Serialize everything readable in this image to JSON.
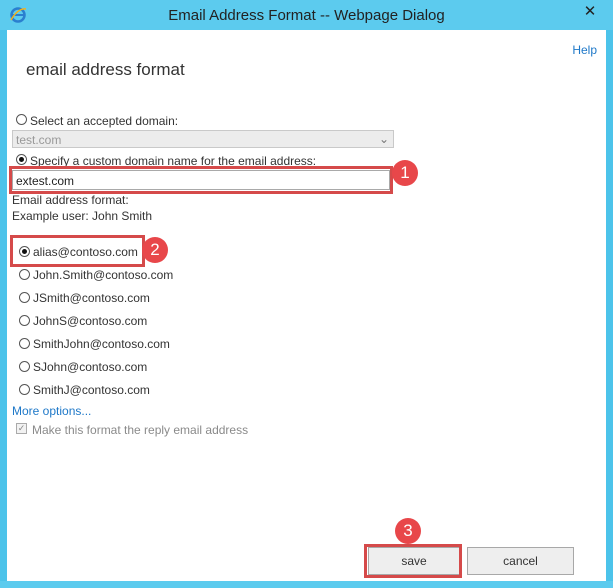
{
  "window": {
    "title": "Email Address Format -- Webpage Dialog",
    "close_glyph": "✕",
    "app_icon": "ie-icon"
  },
  "dialog": {
    "help_label": "Help",
    "heading": "email address format",
    "accepted_domain_label": "Select an accepted domain:",
    "accepted_domain_value": "test.com",
    "custom_domain_label": "Specify a custom domain name for the email address:",
    "custom_domain_value": "extest.com",
    "format_label": "Email address format:",
    "example_user": "Example user: John Smith",
    "formats": [
      {
        "label": "alias@contoso.com",
        "selected": true
      },
      {
        "label": "John.Smith@contoso.com",
        "selected": false
      },
      {
        "label": "JSmith@contoso.com",
        "selected": false
      },
      {
        "label": "JohnS@contoso.com",
        "selected": false
      },
      {
        "label": "SmithJohn@contoso.com",
        "selected": false
      },
      {
        "label": "SJohn@contoso.com",
        "selected": false
      },
      {
        "label": "SmithJ@contoso.com",
        "selected": false
      }
    ],
    "more_options": "More options...",
    "reply_checkbox_label": "Make this format the reply email address",
    "save_label": "save",
    "cancel_label": "cancel"
  },
  "annotations": {
    "step1": "1",
    "step2": "2",
    "step3": "3",
    "highlight_color": "#d54a4a",
    "badge_color": "#e8474a"
  },
  "colors": {
    "frame": "#5ccbee",
    "link": "#1e78c8"
  }
}
